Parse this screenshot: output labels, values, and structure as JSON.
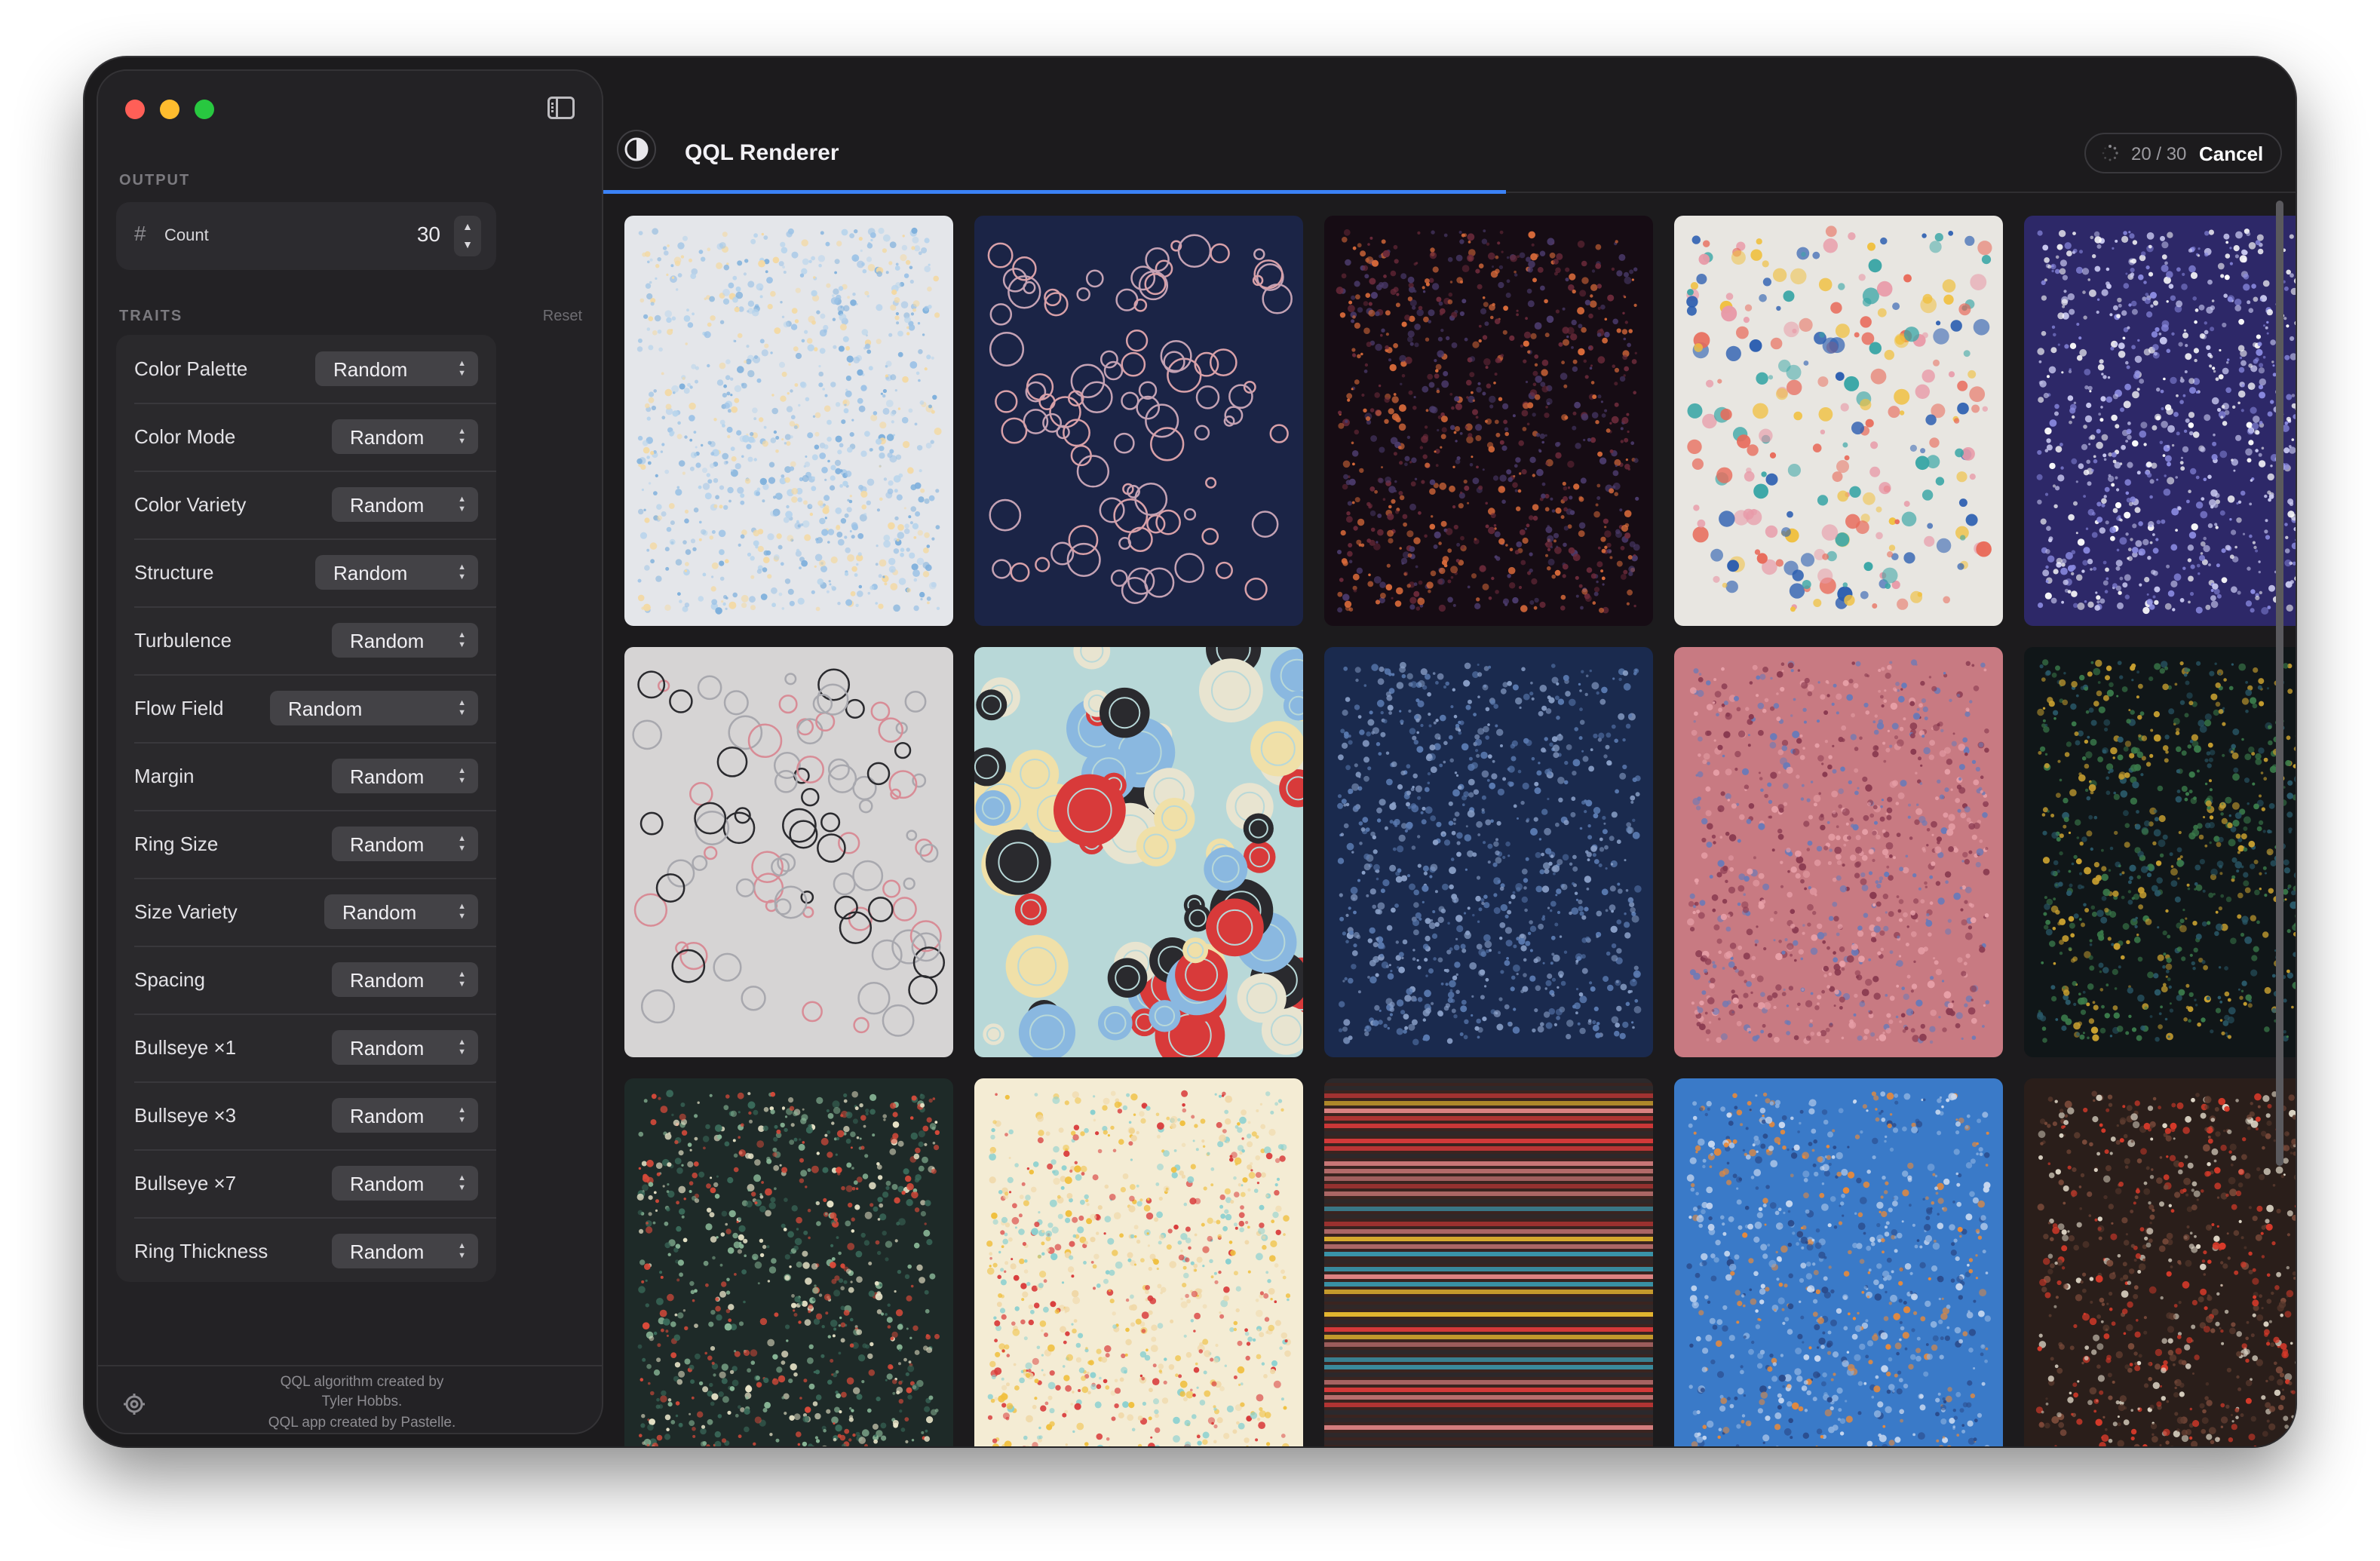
{
  "window": {
    "title": "QQL Renderer",
    "progress_text": "20 / 30",
    "progress_fraction": 0.6667,
    "cancel_label": "Cancel"
  },
  "sidebar": {
    "output_heading": "OUTPUT",
    "count": {
      "label": "Count",
      "value": "30"
    },
    "traits_heading": "TRAITS",
    "reset_label": "Reset",
    "traits": [
      {
        "label": "Color Palette",
        "value": "Random"
      },
      {
        "label": "Color Mode",
        "value": "Random"
      },
      {
        "label": "Color Variety",
        "value": "Random"
      },
      {
        "label": "Structure",
        "value": "Random"
      },
      {
        "label": "Turbulence",
        "value": "Random"
      },
      {
        "label": "Flow Field",
        "value": "Random"
      },
      {
        "label": "Margin",
        "value": "Random"
      },
      {
        "label": "Ring Size",
        "value": "Random"
      },
      {
        "label": "Size Variety",
        "value": "Random"
      },
      {
        "label": "Spacing",
        "value": "Random"
      },
      {
        "label": "Bullseye ×1",
        "value": "Random"
      },
      {
        "label": "Bullseye ×3",
        "value": "Random"
      },
      {
        "label": "Bullseye ×7",
        "value": "Random"
      },
      {
        "label": "Ring Thickness",
        "value": "Random"
      }
    ],
    "footer": [
      "QQL algorithm created by",
      "Tyler Hobbs.",
      "QQL app created by Pastelle."
    ]
  },
  "thumbnails": [
    {
      "bg": "#e4e6ea",
      "colors": [
        "#9dc3e6",
        "#b8d4ec",
        "#f3d9a4",
        "#7fb0dc"
      ],
      "style": "dots"
    },
    {
      "bg": "#1b2446",
      "colors": [
        "#d8a0a8",
        "#c4a2b4"
      ],
      "style": "rings"
    },
    {
      "bg": "#160c14",
      "colors": [
        "#6b2a3a",
        "#4a3a6a",
        "#d86a3a"
      ],
      "style": "dots"
    },
    {
      "bg": "#e8e6e1",
      "colors": [
        "#2a5db0",
        "#e86a5a",
        "#3aa6a6",
        "#f0c040",
        "#e89aa8"
      ],
      "style": "mixed"
    },
    {
      "bg": "#2d2868",
      "colors": [
        "#c8c8f0",
        "#8a8ae0",
        "#ffffff"
      ],
      "style": "dots"
    },
    {
      "bg": "#d6d4d4",
      "colors": [
        "#d88c96",
        "#a8a8ae",
        "#2a2a2e"
      ],
      "style": "rings"
    },
    {
      "bg": "#b8d8d8",
      "colors": [
        "#d83a3a",
        "#2a2a2e",
        "#8ab8e0",
        "#f0e0a8",
        "#e8e4d0"
      ],
      "style": "bigrings"
    },
    {
      "bg": "#1a2a4e",
      "colors": [
        "#5a7ab0",
        "#8aa0c8"
      ],
      "style": "dots"
    },
    {
      "bg": "#c87a82",
      "colors": [
        "#8a3a50",
        "#6a7ab8",
        "#e8a0a8"
      ],
      "style": "dots"
    },
    {
      "bg": "#101618",
      "colors": [
        "#2a5a6a",
        "#c8a030",
        "#3a7a4a"
      ],
      "style": "dots"
    },
    {
      "bg": "#1e2a28",
      "colors": [
        "#e8e4c8",
        "#d84a3a",
        "#3a6a5a",
        "#8ab898"
      ],
      "style": "dots"
    },
    {
      "bg": "#f4ecd4",
      "colors": [
        "#d83a3a",
        "#f0c040",
        "#8ad0d0",
        "#f0d8a8"
      ],
      "style": "dots"
    },
    {
      "bg": "#3a2420",
      "colors": [
        "#d83a3a",
        "#f0c030",
        "#3a9ab0",
        "#e88a8a",
        "#2a2a2e"
      ],
      "style": "stripes"
    },
    {
      "bg": "#3a7ac8",
      "colors": [
        "#8ab0e0",
        "#2a4a8a",
        "#c8d8f0",
        "#e88a3a"
      ],
      "style": "dots"
    },
    {
      "bg": "#2a1e1a",
      "colors": [
        "#5a3a2e",
        "#7a4a3a",
        "#e0d8c8",
        "#d83a2a"
      ],
      "style": "dots"
    }
  ]
}
